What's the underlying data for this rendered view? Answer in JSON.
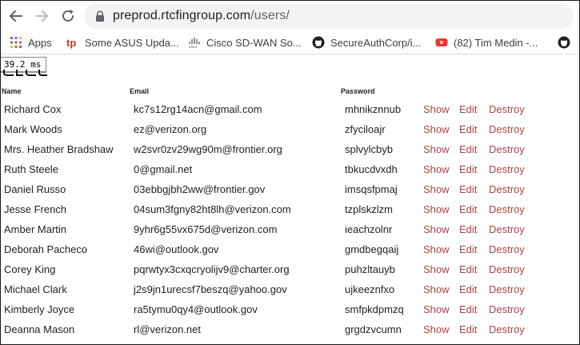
{
  "browser": {
    "url_host": "preprod.rtcfingroup.com",
    "url_path": "/users/"
  },
  "bookmarks": [
    {
      "label": "Apps",
      "icon": "apps-grid-icon"
    },
    {
      "label": "Some ASUS Upda...",
      "icon": "tp-link-icon"
    },
    {
      "label": "Cisco SD-WAN So...",
      "icon": "cisco-icon"
    },
    {
      "label": "SecureAuthCorp/i...",
      "icon": "github-icon"
    },
    {
      "label": "(82) Tim Medin -...",
      "icon": "youtube-icon"
    },
    {
      "label": "",
      "icon": "github-icon"
    }
  ],
  "timing": "39.2 ms",
  "table": {
    "headers": {
      "name": "Name",
      "email": "Email",
      "password": "Password"
    },
    "actions": {
      "show": "Show",
      "edit": "Edit",
      "destroy": "Destroy"
    },
    "rows": [
      {
        "name": "Richard Cox",
        "email": "kc7s12rg14acn@gmail.com",
        "password": "mhnikznnub"
      },
      {
        "name": "Mark Woods",
        "email": "ez@verizon.org",
        "password": "zfyciloajr"
      },
      {
        "name": "Mrs. Heather Bradshaw",
        "email": "w2svr0zv29wg90m@frontier.org",
        "password": "splvylcbyb"
      },
      {
        "name": "Ruth Steele",
        "email": "0@gmail.net",
        "password": "tbkucdvxdh"
      },
      {
        "name": "Daniel Russo",
        "email": "03ebbgjbh2ww@frontier.gov",
        "password": "imsqsfpmaj"
      },
      {
        "name": "Jesse French",
        "email": "04sum3fgny82ht8lh@verizon.com",
        "password": "tzplskzlzm"
      },
      {
        "name": "Amber Martin",
        "email": "9yhr6g55vx675d@verizon.com",
        "password": "ieachzolnr"
      },
      {
        "name": "Deborah Pacheco",
        "email": "46wi@outlook.gov",
        "password": "gmdbegqaij"
      },
      {
        "name": "Corey King",
        "email": "pqrwtyx3cxqcryolijv9@charter.org",
        "password": "puhzltauyb"
      },
      {
        "name": "Michael Clark",
        "email": "j2s9jn1urecsf7beszq@yahoo.gov",
        "password": "ujkeeznfxo"
      },
      {
        "name": "Kimberly Joyce",
        "email": "ra5tymu0qy4@outlook.gov",
        "password": "smfpkdpmzq"
      },
      {
        "name": "Deanna Mason",
        "email": "rl@verizon.net",
        "password": "grgdzvcumn"
      }
    ]
  }
}
